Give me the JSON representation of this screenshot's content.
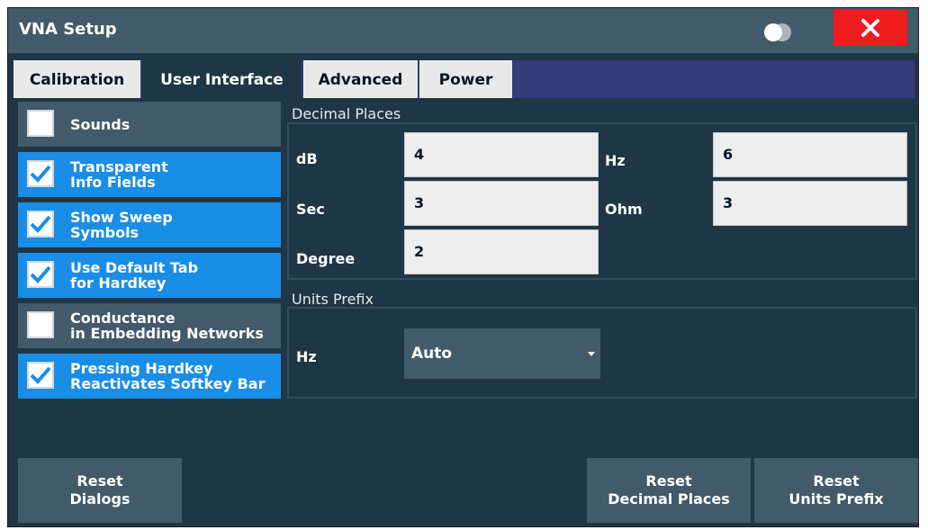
{
  "window": {
    "title": "VNA Setup"
  },
  "tabs": [
    {
      "label": "Calibration",
      "active": false
    },
    {
      "label": "User Interface",
      "active": true
    },
    {
      "label": "Advanced",
      "active": false
    },
    {
      "label": "Power",
      "active": false
    }
  ],
  "options": [
    {
      "label": "Sounds",
      "checked": false
    },
    {
      "label": "Transparent\nInfo Fields",
      "checked": true
    },
    {
      "label": "Show Sweep\nSymbols",
      "checked": true
    },
    {
      "label": "Use Default Tab\nfor Hardkey",
      "checked": true
    },
    {
      "label": "Conductance\nin Embedding Networks",
      "checked": false
    },
    {
      "label": "Pressing Hardkey\nReactivates Softkey Bar",
      "checked": true
    }
  ],
  "decimal_places": {
    "title": "Decimal Places",
    "db": {
      "label": "dB",
      "value": "4"
    },
    "hz": {
      "label": "Hz",
      "value": "6"
    },
    "sec": {
      "label": "Sec",
      "value": "3"
    },
    "ohm": {
      "label": "Ohm",
      "value": "3"
    },
    "degree": {
      "label": "Degree",
      "value": "2"
    }
  },
  "units_prefix": {
    "title": "Units Prefix",
    "hz": {
      "label": "Hz",
      "value": "Auto"
    }
  },
  "buttons": {
    "reset_dialogs": "Reset\nDialogs",
    "reset_decimal_places": "Reset\nDecimal Places",
    "reset_units_prefix": "Reset\nUnits Prefix"
  },
  "colors": {
    "accent": "#1a8de6",
    "close": "#ee1c1c",
    "background": "#1f3646",
    "control": "#425a6a"
  },
  "icons": {
    "toggle": "display-toggle-icon",
    "close": "close-icon",
    "check": "check-icon",
    "dropdown": "chevron-down-icon"
  }
}
